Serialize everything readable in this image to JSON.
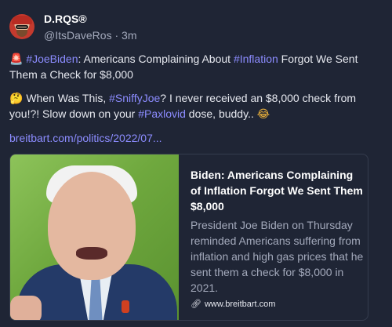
{
  "post": {
    "display_name": "D.RQS®",
    "handle": "@ItsDaveRos",
    "separator": "·",
    "time_ago": "3m",
    "p1": {
      "hashtag1": "#JoeBiden",
      "text1": ": Americans Complaining About ",
      "hashtag2": "#Inflation",
      "text2": " Forgot We Sent Them a Check for $8,000"
    },
    "p2": {
      "text1": " When Was This, ",
      "hashtag1": "#SniffyJoe",
      "text2": "? I never received an $8,000 check from you!?! Slow down on your ",
      "hashtag2": "#Paxlovid",
      "text3": " dose, buddy.. "
    },
    "link_text": "breitbart.com/politics/2022/07...",
    "card": {
      "title": "Biden: Americans Complaining of Inflation Forgot We Sent Them $8,000",
      "description": "President Joe Biden on Thursday reminded Americans suffering from inflation and high gas prices that he sent them a check for $8,000 in 2021.",
      "domain": "www.breitbart.com"
    }
  },
  "icons": {
    "siren": "siren-emoji",
    "thinking": "thinking-emoji",
    "laughing": "laughing-emoji",
    "link": "link-icon"
  },
  "colors": {
    "background": "#1f2535",
    "hashtag": "#8c8cff",
    "muted": "#a3a9bb"
  }
}
